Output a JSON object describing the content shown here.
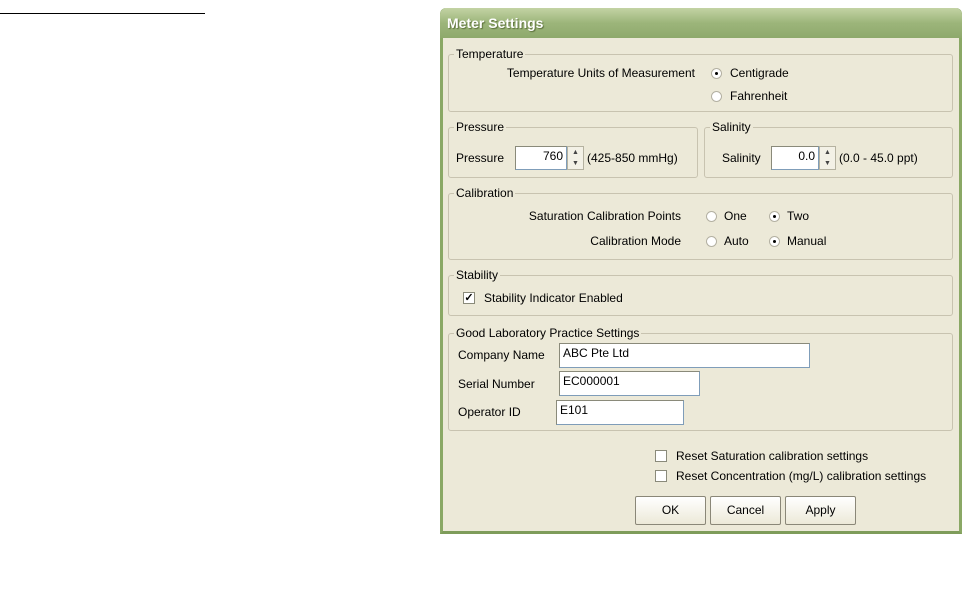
{
  "dialog": {
    "title": "Meter Settings"
  },
  "temperature": {
    "group": "Temperature",
    "label": "Temperature Units of Measurement",
    "options": [
      "Centigrade",
      "Fahrenheit"
    ],
    "selected": "Centigrade"
  },
  "pressure": {
    "group": "Pressure",
    "label": "Pressure",
    "value": "760",
    "range": "(425-850 mmHg)"
  },
  "salinity": {
    "group": "Salinity",
    "label": "Salinity",
    "value": "0.0",
    "range": "(0.0 - 45.0 ppt)"
  },
  "calibration": {
    "group": "Calibration",
    "points_label": "Saturation Calibration Points",
    "points_options": [
      "One",
      "Two"
    ],
    "points_selected": "Two",
    "mode_label": "Calibration Mode",
    "mode_options": [
      "Auto",
      "Manual"
    ],
    "mode_selected": "Manual"
  },
  "stability": {
    "group": "Stability",
    "checkbox_label": "Stability Indicator Enabled",
    "checked": true
  },
  "glp": {
    "group": "Good Laboratory Practice Settings",
    "company_label": "Company Name",
    "company_value": "ABC Pte Ltd",
    "serial_label": "Serial Number",
    "serial_value": "EC000001",
    "operator_label": "Operator ID",
    "operator_value": "E101"
  },
  "reset": {
    "saturation": "Reset Saturation calibration settings",
    "concentration": "Reset Concentration (mg/L) calibration settings"
  },
  "buttons": {
    "ok": "OK",
    "cancel": "Cancel",
    "apply": "Apply"
  }
}
